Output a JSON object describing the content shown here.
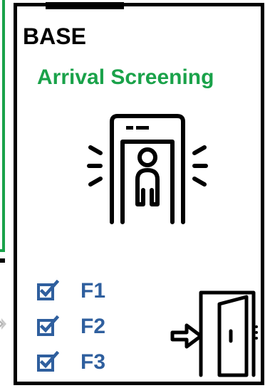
{
  "card": {
    "title": "BASE",
    "subtitle": "Arrival Screening"
  },
  "checklist": [
    {
      "label": "F1",
      "checked": true
    },
    {
      "label": "F2",
      "checked": true
    },
    {
      "label": "F3",
      "checked": true
    }
  ],
  "icons": {
    "scanner": "security-scanner-icon",
    "checkbox": "checked-box-icon",
    "exit": "door-entry-icon"
  },
  "colors": {
    "accent_green": "#1aa24a",
    "checklist_blue": "#2f5f9e",
    "border": "#000000"
  }
}
